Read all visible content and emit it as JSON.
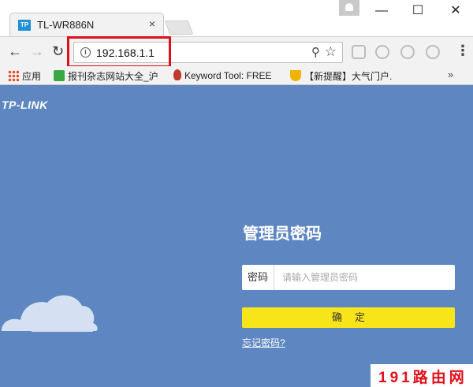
{
  "browser": {
    "tab": {
      "favicon_text": "TP",
      "title": "TL-WR886N",
      "close": "×"
    },
    "window_controls": {
      "minimize": "—",
      "maximize": "☐",
      "close": "✕"
    },
    "nav": {
      "back": "←",
      "forward": "→",
      "reload": "↻"
    },
    "omnibox": {
      "info": "i",
      "url": "192.168.1.1",
      "zoom": "⚲",
      "star": "☆"
    },
    "menu": "⋮",
    "bookmarks": [
      {
        "label": "应用",
        "icon": "apps-grid-icon"
      },
      {
        "label": "报刊杂志网站大全_沪",
        "icon": "green-c-icon"
      },
      {
        "label": "Keyword Tool: FREE",
        "icon": "flame-icon"
      },
      {
        "label": "【新提醒】大气门户.",
        "icon": "trophy-icon"
      }
    ],
    "bookmarks_more": "»"
  },
  "page": {
    "logo": "TP-LINK",
    "heading": "管理员密码",
    "password_label": "密码",
    "password_placeholder": "请输入管理员密码",
    "submit_label": "确定",
    "forgot_link": "忘记密码?"
  },
  "watermark": "191路由网",
  "colors": {
    "page_bg": "#5e87c2",
    "button_bg": "#f8e519",
    "highlight": "#e0101a"
  }
}
